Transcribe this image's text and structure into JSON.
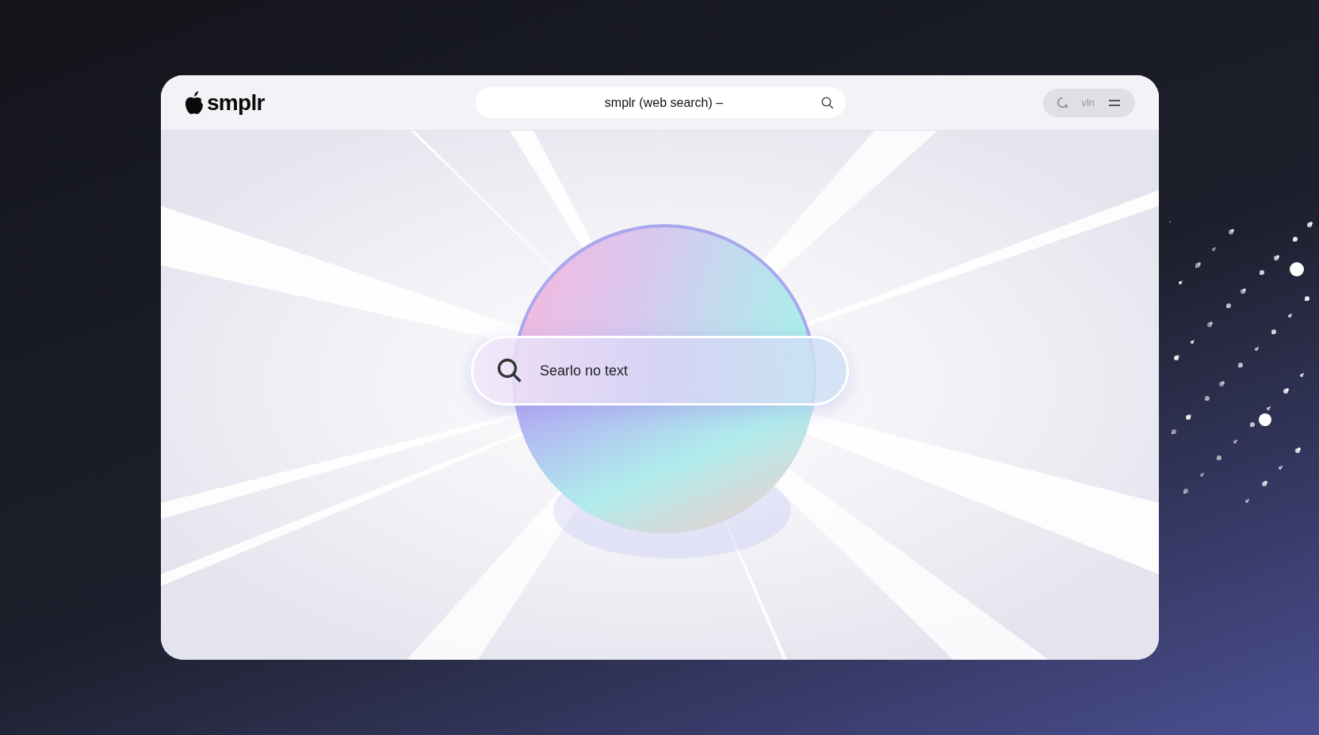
{
  "brand": {
    "name": "smplr"
  },
  "address_bar": {
    "value": "smplr (web search) –"
  },
  "toolbar": {
    "label": "vln"
  },
  "hero_search": {
    "placeholder": "Searlo no text"
  }
}
